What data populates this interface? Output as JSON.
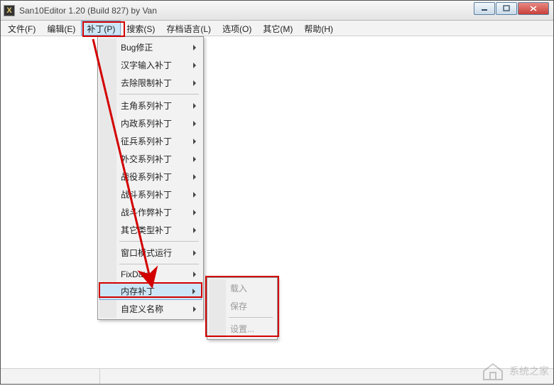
{
  "window": {
    "title": "San10Editor 1.20 (Build 827) by Van",
    "icon_glyph": "X"
  },
  "menubar": [
    {
      "label": "文件(F)",
      "name": "menu-file"
    },
    {
      "label": "编辑(E)",
      "name": "menu-edit"
    },
    {
      "label": "补丁(P)",
      "name": "menu-patch",
      "active": true
    },
    {
      "label": "搜索(S)",
      "name": "menu-search"
    },
    {
      "label": "存档语言(L)",
      "name": "menu-save-language"
    },
    {
      "label": "选项(O)",
      "name": "menu-options"
    },
    {
      "label": "其它(M)",
      "name": "menu-other"
    },
    {
      "label": "帮助(H)",
      "name": "menu-help"
    }
  ],
  "patch_menu": {
    "items": [
      {
        "label": "Bug修正",
        "submenu": true
      },
      {
        "label": "汉字输入补丁",
        "submenu": true
      },
      {
        "label": "去除限制补丁",
        "submenu": true
      },
      {
        "sep": true
      },
      {
        "label": "主角系列补丁",
        "submenu": true
      },
      {
        "label": "内政系列补丁",
        "submenu": true
      },
      {
        "label": "征兵系列补丁",
        "submenu": true
      },
      {
        "label": "外交系列补丁",
        "submenu": true
      },
      {
        "label": "战役系列补丁",
        "submenu": true
      },
      {
        "label": "战斗系列补丁",
        "submenu": true
      },
      {
        "label": "战斗作弊补丁",
        "submenu": true
      },
      {
        "label": "其它类型补丁",
        "submenu": true
      },
      {
        "sep": true
      },
      {
        "label": "窗口模式运行",
        "submenu": true
      },
      {
        "sep": true
      },
      {
        "label": "FixData",
        "submenu": true
      },
      {
        "label": "内存补丁",
        "submenu": true,
        "hover": true
      },
      {
        "label": "自定义名称",
        "submenu": true
      }
    ]
  },
  "memory_submenu": {
    "items": [
      {
        "label": "载入",
        "disabled": true
      },
      {
        "label": "保存",
        "disabled": true
      },
      {
        "sep": true
      },
      {
        "label": "设置...",
        "disabled": true
      }
    ]
  },
  "watermark_text": "系统之家"
}
